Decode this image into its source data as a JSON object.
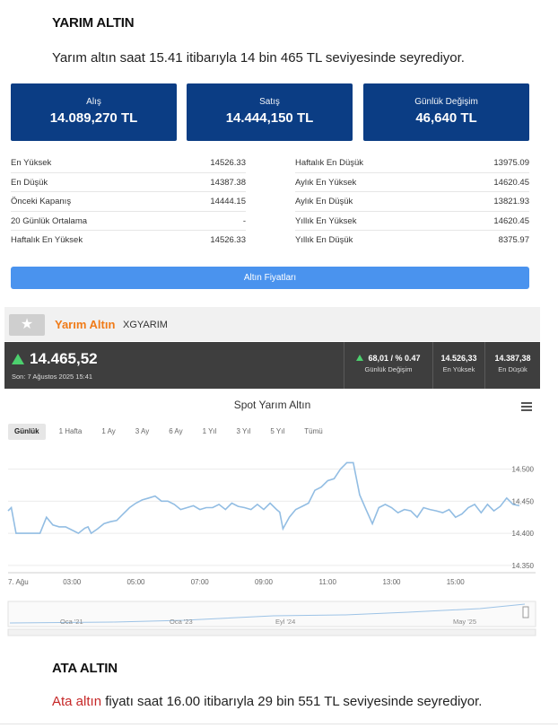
{
  "section1": {
    "heading": "YARIM ALTIN",
    "paragraph": "Yarım altın saat 15.41 itibarıyla 14 bin 465 TL seviyesinde seyrediyor."
  },
  "boxes": [
    {
      "label": "Alış",
      "value": "14.089,270 TL"
    },
    {
      "label": "Satış",
      "value": "14.444,150 TL"
    },
    {
      "label": "Günlük Değişim",
      "value": "46,640 TL"
    }
  ],
  "stats_left": [
    {
      "label": "En Yüksek",
      "value": "14526.33"
    },
    {
      "label": "En Düşük",
      "value": "14387.38"
    },
    {
      "label": "Önceki Kapanış",
      "value": "14444.15"
    },
    {
      "label": "20 Günlük Ortalama",
      "value": "-"
    },
    {
      "label": "Haftalık En Yüksek",
      "value": "14526.33"
    }
  ],
  "stats_right": [
    {
      "label": "Haftalık En Düşük",
      "value": "13975.09"
    },
    {
      "label": "Aylık En Yüksek",
      "value": "14620.45"
    },
    {
      "label": "Aylık En Düşük",
      "value": "13821.93"
    },
    {
      "label": "Yıllık En Yüksek",
      "value": "14620.45"
    },
    {
      "label": "Yıllık En Düşük",
      "value": "8375.97"
    }
  ],
  "prices_button": "Altın Fiyatları",
  "widget": {
    "name": "Yarım Altın",
    "code": "XGYARIM",
    "price": "14.465,52",
    "timestamp": "Son: 7 Ağustos 2025 15:41",
    "change_value": "68,01 / % 0.47",
    "change_label": "Günlük Değişim",
    "high_value": "14.526,33",
    "high_label": "En Yüksek",
    "low_value": "14.387,38",
    "low_label": "En Düşük",
    "up_color": "#4cd06e",
    "brand_color": "#f07b18"
  },
  "chart_data": {
    "type": "line",
    "title": "Spot Yarım Altın",
    "ranges": [
      "Günlük",
      "1 Hafta",
      "1 Ay",
      "3 Ay",
      "6 Ay",
      "1 Yıl",
      "3 Yıl",
      "5 Yıl",
      "Tümü"
    ],
    "active_range": "Günlük",
    "x_ticks": [
      "7. Ağu",
      "03:00",
      "05:00",
      "07:00",
      "09:00",
      "11:00",
      "13:00",
      "15:00"
    ],
    "y_ticks": [
      14350,
      14400,
      14450,
      14500
    ],
    "y_tick_labels": [
      "14.350",
      "14.400",
      "14.450",
      "14.500"
    ],
    "ylim": [
      14340,
      14540
    ],
    "xlim": [
      0,
      16
    ],
    "line_color": "#92bde3",
    "series": [
      {
        "x": [
          0,
          0.1,
          0.25,
          0.5,
          0.75,
          1,
          1.2,
          1.4,
          1.6,
          1.8,
          2,
          2.2,
          2.4,
          2.5,
          2.6,
          2.8,
          3,
          3.2,
          3.4,
          3.6,
          3.8,
          4,
          4.2,
          4.4,
          4.6,
          4.8,
          5,
          5.2,
          5.4,
          5.6,
          5.8,
          6,
          6.2,
          6.4,
          6.6,
          6.8,
          7,
          7.2,
          7.4,
          7.6,
          7.8,
          8,
          8.2,
          8.4,
          8.5,
          8.6,
          8.8,
          9,
          9.2,
          9.4,
          9.6,
          9.8,
          10,
          10.2,
          10.4,
          10.6,
          10.8,
          11,
          11.2,
          11.4,
          11.6,
          11.8,
          12,
          12.2,
          12.4,
          12.6,
          12.8,
          13,
          13.2,
          13.4,
          13.6,
          13.8,
          14,
          14.2,
          14.4,
          14.6,
          14.8,
          15,
          15.2,
          15.4,
          15.6,
          15.8,
          16
        ],
        "y": [
          14435,
          14440,
          14400,
          14400,
          14400,
          14400,
          14425,
          14413,
          14410,
          14410,
          14405,
          14400,
          14408,
          14410,
          14400,
          14407,
          14415,
          14418,
          14420,
          14430,
          14440,
          14447,
          14452,
          14455,
          14458,
          14450,
          14450,
          14445,
          14437,
          14440,
          14443,
          14437,
          14440,
          14440,
          14445,
          14437,
          14447,
          14442,
          14440,
          14437,
          14445,
          14437,
          14447,
          14437,
          14433,
          14407,
          14425,
          14437,
          14442,
          14447,
          14467,
          14472,
          14482,
          14485,
          14500,
          14510,
          14510,
          14460,
          14437,
          14415,
          14440,
          14445,
          14440,
          14432,
          14437,
          14435,
          14425,
          14440,
          14437,
          14435,
          14432,
          14437,
          14425,
          14430,
          14440,
          14445,
          14432,
          14445,
          14435,
          14442,
          14455,
          14445,
          14443
        ]
      }
    ]
  },
  "navigator": {
    "labels": [
      "Oca '21",
      "Oca '23",
      "Eyl '24",
      "May '25"
    ]
  },
  "section2": {
    "heading": "ATA ALTIN",
    "link_text": "Ata altın",
    "paragraph_rest": " fiyatı saat 16.00 itibarıyla 29 bin 551 TL seviyesinde seyrediyor."
  }
}
